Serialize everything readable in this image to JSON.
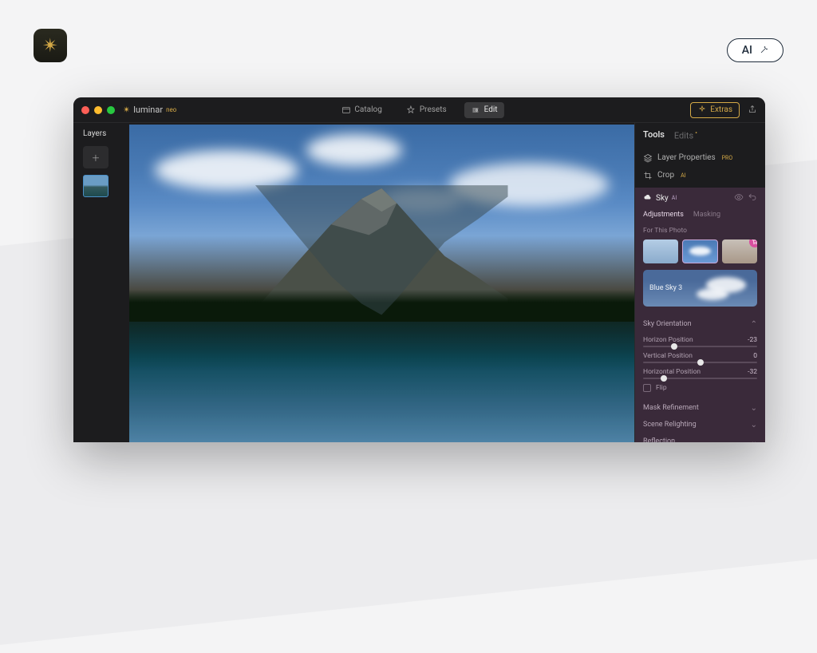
{
  "page": {
    "ai_pill_label": "AI"
  },
  "app": {
    "name": "luminar",
    "edition_badge": "neo"
  },
  "titlebar": {
    "tabs": {
      "catalog": "Catalog",
      "presets": "Presets",
      "edit": "Edit"
    },
    "extras": "Extras"
  },
  "layers": {
    "title": "Layers"
  },
  "tools": {
    "tabs": {
      "tools": "Tools",
      "edits": "Edits"
    },
    "layer_properties": "Layer Properties",
    "layer_properties_badge": "PRO",
    "crop": "Crop",
    "crop_badge": "AI"
  },
  "sky": {
    "title": "Sky",
    "ai_badge": "AI",
    "subtabs": {
      "adjustments": "Adjustments",
      "masking": "Masking"
    },
    "for_this_photo": "For This Photo",
    "selected_sky_label": "Blue Sky 3",
    "orientation": {
      "title": "Sky Orientation",
      "horizon_position_label": "Horizon Position",
      "horizon_position_value": "-23",
      "vertical_position_label": "Vertical Position",
      "vertical_position_value": "0",
      "horizontal_position_label": "Horizontal Position",
      "horizontal_position_value": "-32",
      "flip_label": "Flip"
    },
    "sections": {
      "mask_refinement": "Mask Refinement",
      "scene_relighting": "Scene Relighting",
      "reflection": "Reflection"
    }
  }
}
